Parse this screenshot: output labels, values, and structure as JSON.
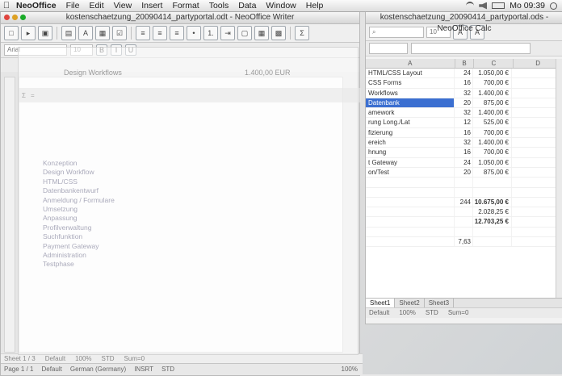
{
  "menubar": {
    "app": "NeoOffice",
    "items": [
      "File",
      "Edit",
      "View",
      "Insert",
      "Format",
      "Tools",
      "Data",
      "Window",
      "Help"
    ],
    "clock": "Mo 09:39"
  },
  "writer": {
    "title": "kostenschaetzung_20090414_partyportal.odt - NeoOffice Writer",
    "zoom": "100%",
    "status_page": "Page 1 / 1",
    "status_style": "Default",
    "status_lang": "German (Germany)",
    "status_mode": "INSRT",
    "status_std": "STD",
    "font": "Arial",
    "size": "10",
    "sheet_status": [
      "Sheet 1 / 3",
      "Default",
      "100%",
      "STD",
      "Sum=0"
    ]
  },
  "ghost": {
    "title": "Design Workflows",
    "price": "1.400,00 EUR",
    "list": [
      "Konzeption",
      "Design Workflow",
      "HTML/CSS",
      "Datenbankentwurf",
      "Anmeldung / Formulare",
      "Umsetzung",
      "Anpassung",
      "Profilverwaltung",
      "Suchfunktion",
      "Payment Gateway",
      "Administration",
      "Testphase"
    ]
  },
  "calc": {
    "title": "kostenschaetzung_20090414_partyportal.ods - NeoOffice Calc",
    "font_size": "10",
    "columns": [
      "A",
      "B",
      "C",
      "D"
    ],
    "rows": [
      {
        "a": "HTML/CSS Layout",
        "b": "24",
        "c": "1.050,00 €"
      },
      {
        "a": "CSS Forms",
        "b": "16",
        "c": "700,00 €"
      },
      {
        "a": "Workflows",
        "b": "32",
        "c": "1.400,00 €"
      },
      {
        "a": "Datenbank",
        "b": "20",
        "c": "875,00 €",
        "hl": true
      },
      {
        "a": "amework",
        "b": "32",
        "c": "1.400,00 €"
      },
      {
        "a": "rung Long./Lat",
        "b": "12",
        "c": "525,00 €"
      },
      {
        "a": "fizierung",
        "b": "16",
        "c": "700,00 €"
      },
      {
        "a": "ereich",
        "b": "32",
        "c": "1.400,00 €"
      },
      {
        "a": "hnung",
        "b": "16",
        "c": "700,00 €"
      },
      {
        "a": "t Gateway",
        "b": "24",
        "c": "1.050,00 €"
      },
      {
        "a": "on/Test",
        "b": "20",
        "c": "875,00 €"
      },
      {
        "a": "",
        "b": "",
        "c": ""
      },
      {
        "a": "",
        "b": "",
        "c": ""
      },
      {
        "a": "",
        "b": "244",
        "c": "10.675,00 €",
        "bold": true
      },
      {
        "a": "",
        "b": "",
        "c": "2.028,25 €"
      },
      {
        "a": "",
        "b": "",
        "c": "12.703,25 €",
        "bold": true
      },
      {
        "a": "",
        "b": "",
        "c": ""
      },
      {
        "a": "",
        "b": "7,63",
        "c": ""
      }
    ],
    "tabs": [
      "Sheet1",
      "Sheet2",
      "Sheet3"
    ],
    "status": [
      "Default",
      "100%",
      "STD",
      "Sum=0"
    ]
  }
}
